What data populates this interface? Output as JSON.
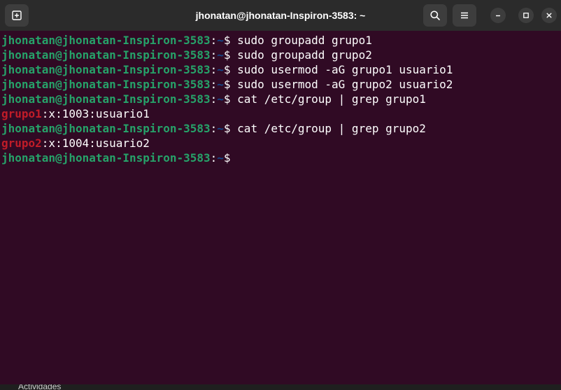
{
  "window": {
    "title": "jhonatan@jhonatan-Inspiron-3583: ~"
  },
  "header": {
    "icons": {
      "new_tab": "new-tab-icon",
      "search": "search-icon",
      "menu": "hamburger-menu-icon",
      "minimize": "minimize-icon",
      "maximize": "maximize-icon",
      "close": "close-icon"
    }
  },
  "colors": {
    "terminal_background": "#300a24",
    "prompt_user": "#26a269",
    "prompt_path": "#12488b",
    "grep_match": "#c01c28",
    "text": "#ffffff"
  },
  "terminal": {
    "prompt": {
      "user_host": "jhonatan@jhonatan-Inspiron-3583",
      "colon": ":",
      "path": "~",
      "dollar": "$ "
    },
    "lines": [
      {
        "type": "command",
        "command": "sudo groupadd grupo1"
      },
      {
        "type": "command",
        "command": "sudo groupadd grupo2"
      },
      {
        "type": "command",
        "command": "sudo usermod -aG grupo1 usuario1"
      },
      {
        "type": "command",
        "command": "sudo usermod -aG grupo2 usuario2"
      },
      {
        "type": "command",
        "command": "cat /etc/group | grep grupo1"
      },
      {
        "type": "output",
        "match": "grupo1",
        "rest": ":x:1003:usuario1"
      },
      {
        "type": "command",
        "command": "cat /etc/group | grep grupo2"
      },
      {
        "type": "output",
        "match": "grupo2",
        "rest": ":x:1004:usuario2"
      },
      {
        "type": "command",
        "command": ""
      }
    ]
  },
  "taskbar": {
    "label": "Actividades"
  }
}
